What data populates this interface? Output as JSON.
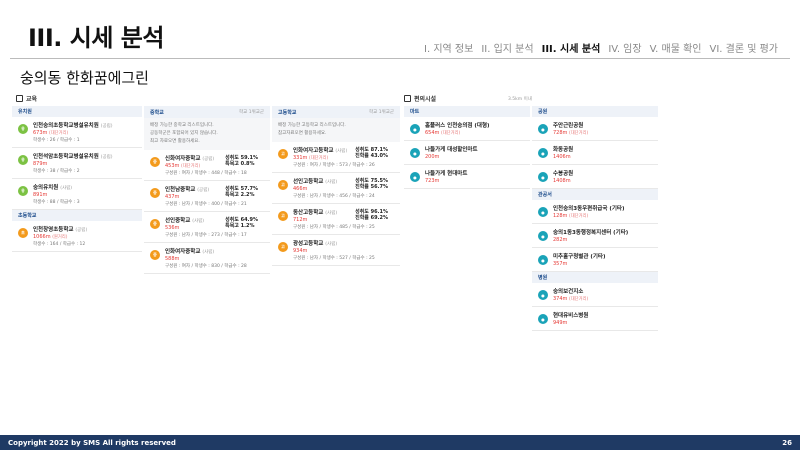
{
  "header": {
    "title": "III. 시세 분석",
    "nav": [
      "I. 지역 정보",
      "II. 입지 분석",
      "III. 시세 분석",
      "IV. 임장",
      "V. 매물 확인",
      "VI. 결론 및 평가"
    ],
    "nav_active": 2
  },
  "subtitle": "숭의동 한화꿈에그린",
  "education": {
    "heading": "교육",
    "kindergarten": {
      "label": "유치원",
      "items": [
        {
          "name": "인천숭의초등학교병설유치원",
          "tag": "(공립)",
          "dist": "673m",
          "dist_tag": "(대단거리)",
          "meta": "학생수 : 26 / 학급수 : 1"
        },
        {
          "name": "인천석암초등학교병설유치원",
          "tag": "(공립)",
          "dist": "879m",
          "dist_tag": "",
          "meta": "학생수 : 38 / 학급수 : 2"
        },
        {
          "name": "숭의유치원",
          "tag": "(사립)",
          "dist": "891m",
          "dist_tag": "",
          "meta": "학생수 : 88 / 학급수 : 3"
        }
      ]
    },
    "elementary": {
      "label": "초등학교",
      "items": [
        {
          "name": "인천창영초등학교",
          "tag": "(공립)",
          "dist": "1066m",
          "dist_tag": "(원거리)",
          "meta": "학생수 : 164 / 학급수 : 12"
        }
      ]
    },
    "middle": {
      "label": "중학교",
      "note": "학교 1위교군",
      "notice": [
        "배정 가능한 중학교 리스트입니다.",
        "공동학군은 포함되어 있지 않습니다.",
        "최고 자료오면 활용하세요."
      ],
      "items": [
        {
          "name": "신화여자중학교",
          "tag": "(공립)",
          "dist": "453m",
          "dist_tag": "(대단거리)",
          "meta": "구성원 : 여자 / 학생수 : 448 / 학급수 : 18",
          "rate1": "성취도 59.1%",
          "rate2": "특목고 0.8%"
        },
        {
          "name": "인천남중학교",
          "tag": "(공립)",
          "dist": "437m",
          "dist_tag": "",
          "meta": "구성원 : 남자 / 학생수 : 400 / 학급수 : 21",
          "rate1": "성취도 57.7%",
          "rate2": "특목고 2.2%"
        },
        {
          "name": "선인중학교",
          "tag": "(사립)",
          "dist": "536m",
          "dist_tag": "",
          "meta": "구성원 : 남자 / 학생수 : 273 / 학급수 : 17",
          "rate1": "성취도 64.9%",
          "rate2": "특목고 1.2%"
        },
        {
          "name": "인화여자중학교",
          "tag": "(사립)",
          "dist": "588m",
          "dist_tag": "",
          "meta": "구성원 : 여자 / 학생수 : 830 / 학급수 : 28",
          "rate1": "",
          "rate2": ""
        }
      ]
    },
    "high": {
      "label": "고등학교",
      "note": "학교 1위교군",
      "notice": [
        "배정 가능한 고등학교 리스트입니다.",
        "참고자료오면 활용하세요."
      ],
      "items": [
        {
          "name": "인화여자고등학교",
          "tag": "(사립)",
          "dist": "331m",
          "dist_tag": "(대단거리)",
          "meta": "구성원 : 여자 / 학생수 : 573 / 학급수 : 26",
          "rate1": "성취도 87.1%",
          "rate2": "진학률 43.0%"
        },
        {
          "name": "선인고등학교",
          "tag": "(사립)",
          "dist": "466m",
          "dist_tag": "",
          "meta": "구성원 : 남자 / 학생수 : 456 / 학급수 : 24",
          "rate1": "성취도 75.5%",
          "rate2": "진학률 56.7%"
        },
        {
          "name": "동산고등학교",
          "tag": "(사립)",
          "dist": "712m",
          "dist_tag": "",
          "meta": "구성원 : 남자 / 학생수 : 485 / 학급수 : 25",
          "rate1": "성취도 96.1%",
          "rate2": "진학률 69.2%"
        },
        {
          "name": "광성고등학교",
          "tag": "(사립)",
          "dist": "934m",
          "dist_tag": "",
          "meta": "구성원 : 남자 / 학생수 : 527 / 학급수 : 25",
          "rate1": "",
          "rate2": ""
        }
      ]
    }
  },
  "amenities": {
    "heading": "편의시설",
    "note": "3.5km 이내",
    "mart": {
      "label": "마트",
      "items": [
        {
          "name": "홈플러스 인천숭의점 (대형)",
          "dist": "654m",
          "dist_tag": "(대단거리)"
        },
        {
          "name": "나들가게 대성할인마트",
          "dist": "200m",
          "dist_tag": ""
        },
        {
          "name": "나들가게 현대마트",
          "dist": "723m",
          "dist_tag": ""
        }
      ]
    },
    "park": {
      "label": "공원",
      "items": [
        {
          "name": "주안근린공원",
          "dist": "728m",
          "dist_tag": "(대단거리)"
        },
        {
          "name": "화동공원",
          "dist": "1406m",
          "dist_tag": ""
        },
        {
          "name": "수봉공원",
          "dist": "1408m",
          "dist_tag": ""
        }
      ]
    },
    "public": {
      "label": "관공서",
      "items": [
        {
          "name": "인천숭의3동우편취급국 (기타)",
          "dist": "128m",
          "dist_tag": "(대단거리)"
        },
        {
          "name": "숭의1동3동행정복지센터 (기타)",
          "dist": "282m",
          "dist_tag": ""
        },
        {
          "name": "미추홀구청별관 (기타)",
          "dist": "357m",
          "dist_tag": ""
        }
      ]
    },
    "hospital": {
      "label": "병원",
      "items": [
        {
          "name": "숭의보건지소",
          "dist": "374m",
          "dist_tag": "(대단거리)"
        },
        {
          "name": "현대유비스병원",
          "dist": "949m",
          "dist_tag": ""
        }
      ]
    }
  },
  "footer": {
    "copyright": "Copyright 2022 by SMS All rights reserved",
    "page": "26"
  },
  "colors": {
    "green": "#7cc243",
    "orange": "#f39a1c",
    "teal": "#1aa3b8",
    "navy": "#1f3a64",
    "red": "#e53935"
  }
}
